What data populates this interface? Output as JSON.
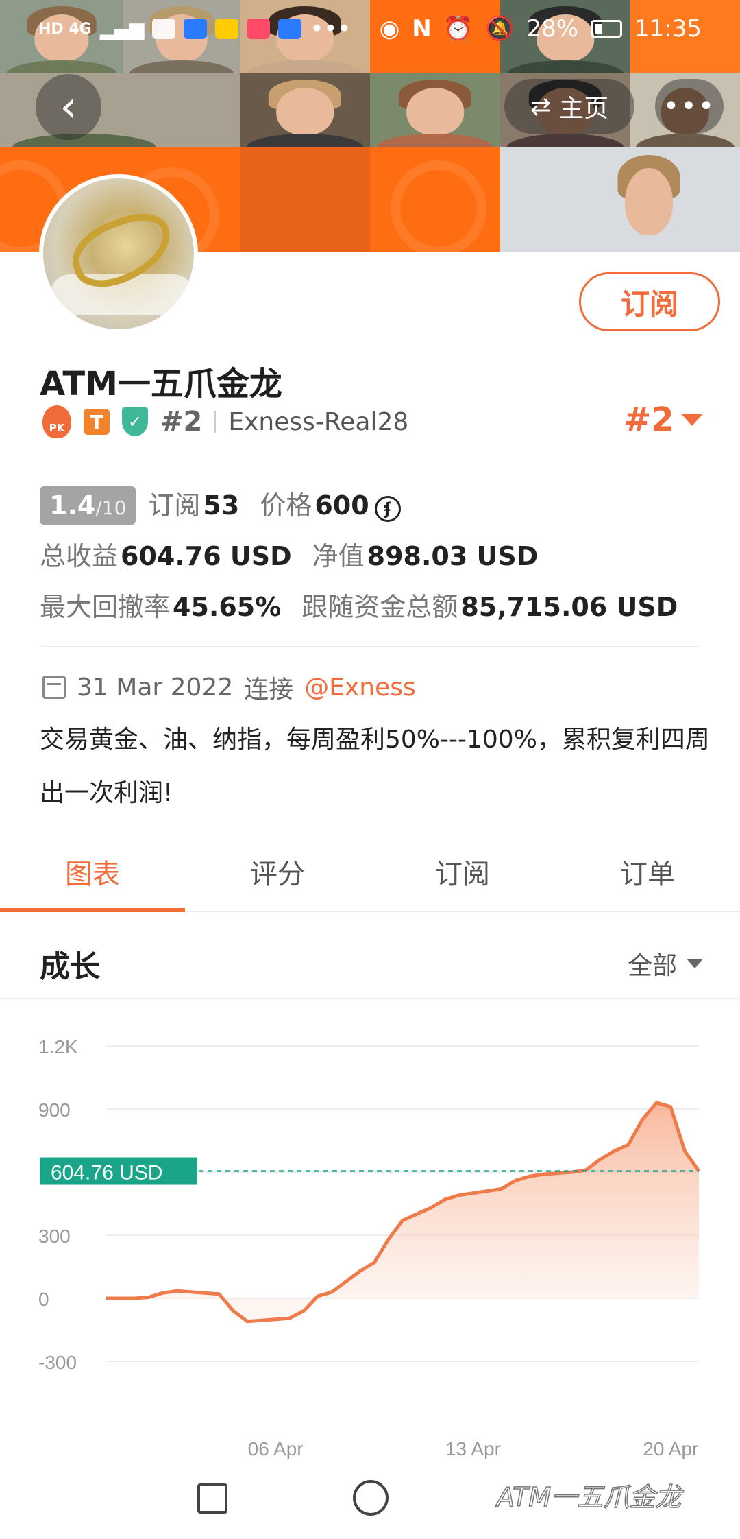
{
  "status_bar": {
    "left_text": "HD 4G",
    "battery": "28%",
    "time": "11:35"
  },
  "header": {
    "home_label": "主页",
    "more_label": "•••"
  },
  "profile": {
    "name": "ATM一五爪金龙",
    "subscribe_label": "订阅",
    "pk_badge": "PK",
    "t_badge": "T",
    "rank_small": "#2",
    "account": "Exness-Real28",
    "rank_big": "#2",
    "score": "1.4",
    "score_den": "/10",
    "subscribe_count_label": "订阅",
    "subscribe_count": "53",
    "price_label": "价格",
    "price": "600",
    "price_coin": "ʄ",
    "total_profit_label": "总收益",
    "total_profit": "604.76 USD",
    "equity_label": "净值",
    "equity": "898.03 USD",
    "max_drawdown_label": "最大回撤率",
    "max_drawdown": "45.65%",
    "follow_funds_label": "跟随资金总额",
    "follow_funds": "85,715.06 USD",
    "join_date": "31 Mar 2022",
    "join_text": "连接",
    "broker": "@Exness",
    "description": "交易黄金、油、纳指，每周盈利50%---100%，累积复利四周出一次利润!"
  },
  "tabs": [
    {
      "label": "图表",
      "active": true
    },
    {
      "label": "评分",
      "active": false
    },
    {
      "label": "订阅",
      "active": false
    },
    {
      "label": "订单",
      "active": false
    }
  ],
  "section": {
    "title": "成长",
    "filter": "全部"
  },
  "colors": {
    "accent": "#f26b3a",
    "teal": "#1aa588",
    "line": "#ef7a4a"
  },
  "chart_data": {
    "type": "area",
    "yticks": [
      "1.2K",
      "900",
      "300",
      "0",
      "-300"
    ],
    "xticks": [
      "06 Apr",
      "13 Apr",
      "20 Apr"
    ],
    "ylim": [
      -300,
      1200
    ],
    "current_value_label": "604.76 USD",
    "current_value": 604.76,
    "x": [
      0,
      0.5,
      1,
      1.5,
      2,
      2.5,
      3,
      3.5,
      4,
      4.5,
      5,
      5.5,
      6,
      6.5,
      7,
      7.5,
      8,
      8.5,
      9,
      9.5,
      10,
      10.5,
      11,
      11.5,
      12,
      12.5,
      13,
      13.5,
      14,
      14.5,
      15,
      15.5,
      16,
      16.5,
      17,
      17.5,
      18,
      18.5,
      19,
      19.5,
      20,
      20.5,
      21
    ],
    "values": [
      0,
      0,
      0,
      5,
      25,
      35,
      30,
      25,
      20,
      -60,
      -110,
      -105,
      -100,
      -95,
      -60,
      10,
      30,
      80,
      130,
      170,
      280,
      370,
      400,
      430,
      470,
      490,
      500,
      510,
      520,
      560,
      580,
      590,
      595,
      600,
      610,
      660,
      700,
      730,
      850,
      930,
      910,
      700,
      604.76
    ]
  }
}
